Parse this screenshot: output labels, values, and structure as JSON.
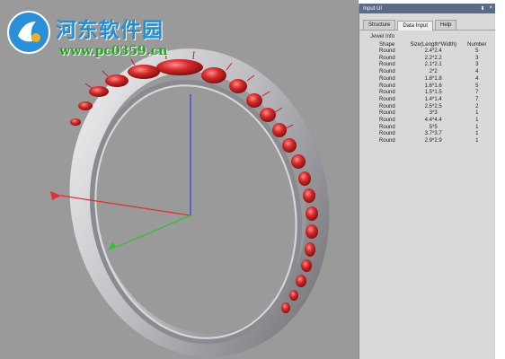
{
  "watermark": {
    "title": "河东软件园",
    "url": "www.pc0359.cn"
  },
  "panel": {
    "title": "Input UI",
    "controls": [
      "⬍",
      "×"
    ],
    "tabs": [
      {
        "label": "Structure",
        "active": false
      },
      {
        "label": "Data Input",
        "active": true
      },
      {
        "label": "Help",
        "active": false
      }
    ],
    "section_label": "Jewel Info",
    "table": {
      "headers": [
        "Shape",
        "Size(Length*Width)",
        "Number"
      ],
      "rows": [
        [
          "Round",
          "2.4*2.4",
          "5"
        ],
        [
          "Round",
          "2.2*2.2",
          "3"
        ],
        [
          "Round",
          "2.1*2.1",
          "3"
        ],
        [
          "Round",
          "2*2",
          "4"
        ],
        [
          "Round",
          "1.8*1.8",
          "4"
        ],
        [
          "Round",
          "1.6*1.6",
          "5"
        ],
        [
          "Round",
          "1.5*1.5",
          "7"
        ],
        [
          "Round",
          "1.4*1.4",
          "7"
        ],
        [
          "Round",
          "2.5*2.5",
          "2"
        ],
        [
          "Round",
          "3*3",
          "1"
        ],
        [
          "Round",
          "4.4*4.4",
          "1"
        ],
        [
          "Round",
          "5*5",
          "1"
        ],
        [
          "Round",
          "3.7*3.7",
          "1"
        ],
        [
          "Round",
          "2.9*2.9",
          "1"
        ]
      ]
    }
  },
  "colors": {
    "viewport_bg": "#9a9a9a",
    "gem": "#d42a2a",
    "band": "#c8c8cc",
    "axis_x": "#e03030",
    "axis_y": "#30c030",
    "axis_z": "#3040e0",
    "watermark_title": "#1f8fd6",
    "watermark_url": "#2aa32a"
  }
}
